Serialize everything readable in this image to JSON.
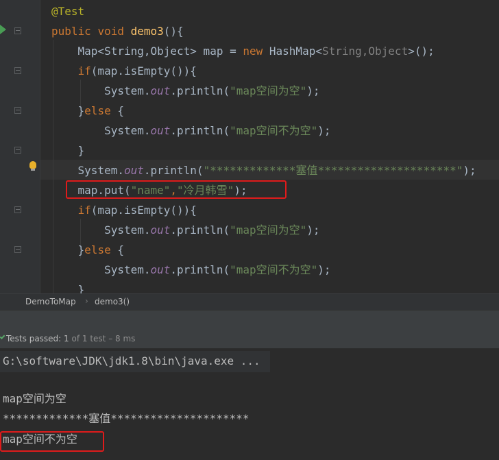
{
  "editor": {
    "lines": [
      {
        "tokens": [
          {
            "t": "@Test",
            "c": "ann"
          }
        ]
      },
      {
        "tokens": [
          {
            "t": "public",
            "c": "kw"
          },
          {
            "t": " "
          },
          {
            "t": "void",
            "c": "kw"
          },
          {
            "t": " "
          },
          {
            "t": "demo3",
            "c": "fn"
          },
          {
            "t": "(){"
          }
        ]
      },
      {
        "tokens": [
          {
            "t": "    Map<String,Object> map = "
          },
          {
            "t": "new",
            "c": "kw"
          },
          {
            "t": " HashMap<"
          },
          {
            "t": "String,Object",
            "c": "gen"
          },
          {
            "t": ">();"
          }
        ]
      },
      {
        "tokens": [
          {
            "t": "    "
          },
          {
            "t": "if",
            "c": "kw"
          },
          {
            "t": "(map.isEmpty()){"
          }
        ]
      },
      {
        "tokens": [
          {
            "t": "        System."
          },
          {
            "t": "out",
            "c": "fld"
          },
          {
            "t": ".println("
          },
          {
            "t": "\"map空间为空\"",
            "c": "str"
          },
          {
            "t": ");"
          }
        ]
      },
      {
        "tokens": [
          {
            "t": "    }"
          },
          {
            "t": "else",
            "c": "kw"
          },
          {
            "t": " {"
          }
        ]
      },
      {
        "tokens": [
          {
            "t": "        System."
          },
          {
            "t": "out",
            "c": "fld"
          },
          {
            "t": ".println("
          },
          {
            "t": "\"map空间不为空\"",
            "c": "str"
          },
          {
            "t": ");"
          }
        ]
      },
      {
        "tokens": [
          {
            "t": "    }"
          }
        ]
      },
      {
        "tokens": [
          {
            "t": "    System."
          },
          {
            "t": "out",
            "c": "fld"
          },
          {
            "t": ".println("
          },
          {
            "t": "\"*************塞值*********************\"",
            "c": "str"
          },
          {
            "t": ");"
          }
        ]
      },
      {
        "tokens": [
          {
            "t": "    map.put("
          },
          {
            "t": "\"name\"",
            "c": "str"
          },
          {
            "t": ",",
            "c": "cm"
          },
          {
            "t": "\"冷月韩雪\"",
            "c": "str"
          },
          {
            "t": ");"
          }
        ]
      },
      {
        "tokens": [
          {
            "t": "    "
          },
          {
            "t": "if",
            "c": "kw"
          },
          {
            "t": "(map.isEmpty()){"
          }
        ]
      },
      {
        "tokens": [
          {
            "t": "        System."
          },
          {
            "t": "out",
            "c": "fld"
          },
          {
            "t": ".println("
          },
          {
            "t": "\"map空间为空\"",
            "c": "str"
          },
          {
            "t": ");"
          }
        ]
      },
      {
        "tokens": [
          {
            "t": "    }"
          },
          {
            "t": "else",
            "c": "kw"
          },
          {
            "t": " {"
          }
        ]
      },
      {
        "tokens": [
          {
            "t": "        System."
          },
          {
            "t": "out",
            "c": "fld"
          },
          {
            "t": ".println("
          },
          {
            "t": "\"map空间不为空\"",
            "c": "str"
          },
          {
            "t": ");"
          }
        ]
      },
      {
        "tokens": [
          {
            "t": "    }"
          }
        ]
      }
    ]
  },
  "breadcrumb": {
    "class_name": "DemoToMap",
    "method_name": "demo3()"
  },
  "tests": {
    "label": "Tests passed:",
    "passed": "1",
    "summary": "of 1 test – 8 ms"
  },
  "console": {
    "command": "G:\\software\\JDK\\jdk1.8\\bin\\java.exe ...",
    "output": [
      "map空间为空",
      "*************塞值*********************",
      "map空间不为空"
    ]
  },
  "colors": {
    "highlight_box": "#e01b1b",
    "pass_icon": "#59a869"
  }
}
